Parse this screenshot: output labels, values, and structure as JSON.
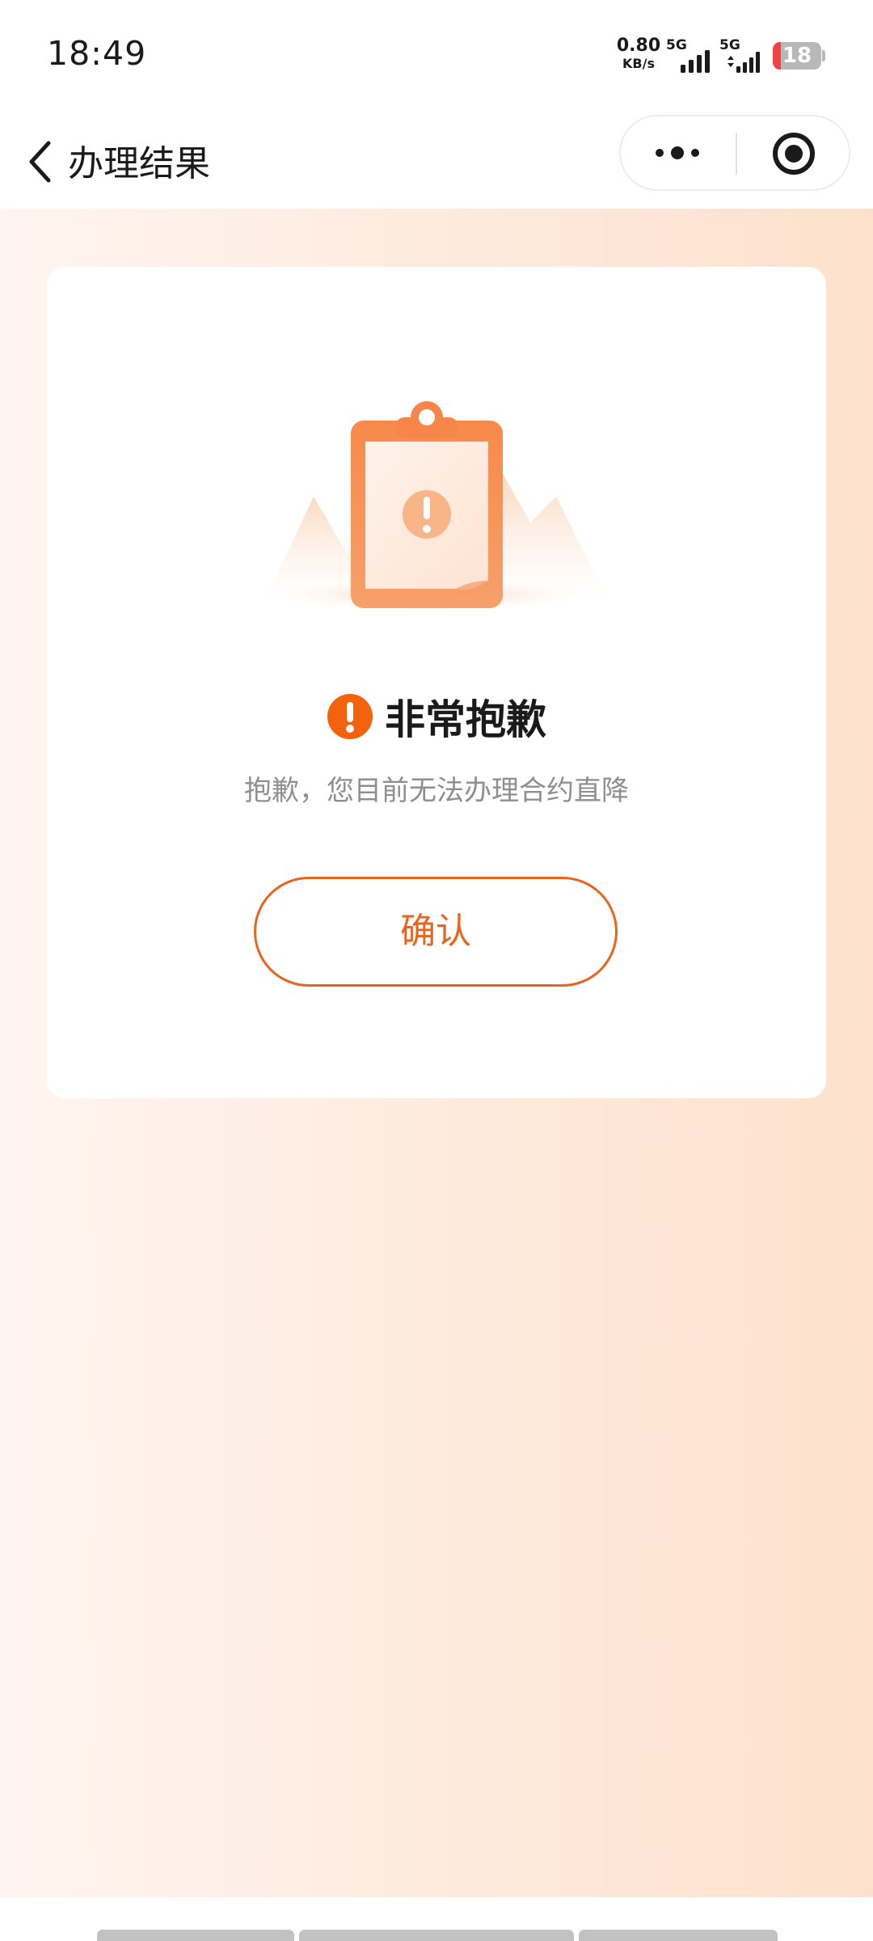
{
  "status_bar": {
    "time": "18:49",
    "net_speed_value": "0.80",
    "net_speed_unit": "KB/s",
    "sim1_network": "5G",
    "sim2_network": "5G",
    "battery_level": "18"
  },
  "nav": {
    "title": "办理结果"
  },
  "result": {
    "title": "非常抱歉",
    "message": "抱歉，您目前无法办理合约直降",
    "confirm_label": "确认"
  },
  "icons": {
    "back": "chevron-left-icon",
    "more": "more-dots-icon",
    "close": "target-close-icon",
    "warning": "exclamation-circle-icon",
    "illustration": "clipboard-warning-illustration"
  },
  "colors": {
    "accent": "#E8651D",
    "warning_icon": "#F4620E",
    "background_gradient": [
      "#FFF5F0",
      "#FDE1CD"
    ]
  }
}
